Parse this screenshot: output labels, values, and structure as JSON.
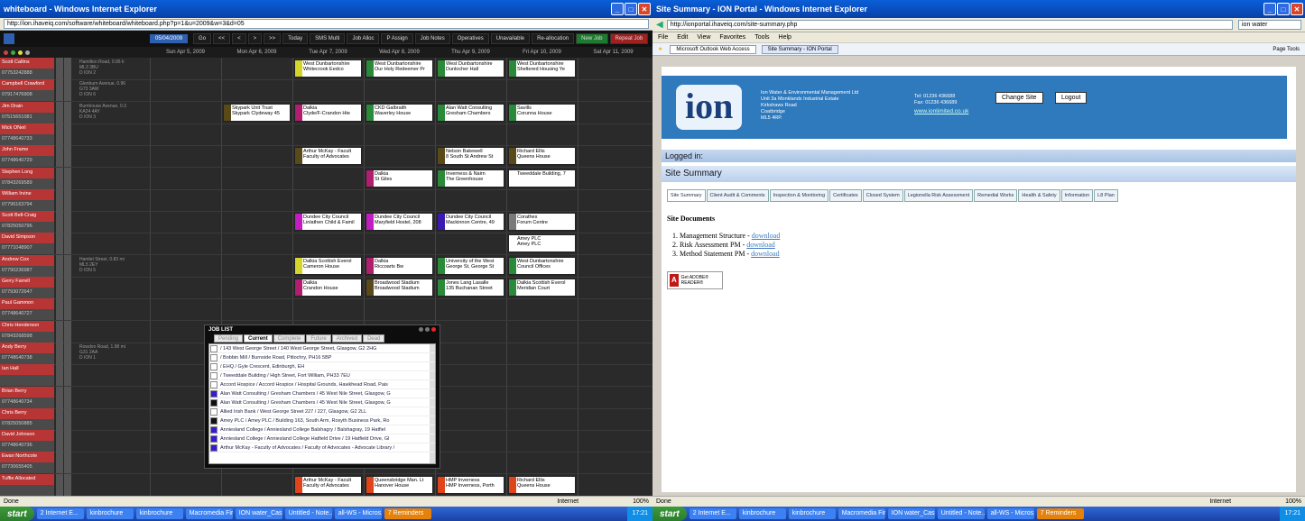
{
  "left": {
    "title": "whiteboard - Windows Internet Explorer",
    "url": "http://ion.ihaveiq.com/software/whiteboard/whiteboard.php?p=1&u=2009&w=3&d=05",
    "toolbar": {
      "date": "05/04/2009",
      "buttons": [
        "Go",
        "<<",
        "<",
        ">",
        ">>",
        "Today",
        "SMS Multi",
        "Job Alloc",
        "P Assign",
        "Job Notes",
        "Operatives",
        "Unavailable",
        "Re-allocation",
        "New Job",
        "Repeat Job"
      ]
    },
    "days": [
      "Sun Apr 5, 2009",
      "Mon Apr 6, 2009",
      "Tue Apr 7, 2009",
      "Wed Apr 8, 2009",
      "Thu Apr 9, 2009",
      "Fri Apr 10, 2009",
      "Sat Apr 11, 2009"
    ],
    "operatives": [
      {
        "name": "Scott Callins",
        "phone": "07753242888",
        "loc": "Hamilton Road, 0.95 k|ML3 3BU|D  ION 2"
      },
      {
        "name": "Campbell Crawford",
        "phone": "07917476908",
        "loc": "Glenburn Avenue, 0.96|G73 3AW|D  ION 6"
      },
      {
        "name": "Jim Drain",
        "phone": "07515651081",
        "loc": "Burnhouse Avenue, 0.3|KA24 4AY|D  ION 3"
      },
      {
        "name": "Mick ONeil",
        "phone": "07748640733",
        "loc": ""
      },
      {
        "name": "John Frame",
        "phone": "07748640729",
        "loc": ""
      },
      {
        "name": "Stephen Long",
        "phone": "07843269589",
        "loc": ""
      },
      {
        "name": "William Irvine",
        "phone": "07796163794",
        "loc": ""
      },
      {
        "name": "Scott Bell-Craig",
        "phone": "07825050796",
        "loc": ""
      },
      {
        "name": "David Simpson",
        "phone": "07771048907",
        "loc": ""
      },
      {
        "name": "Andrew Cox",
        "phone": "07790236987",
        "loc": "Hamlet Street, 0.83 mi|ML5 2EY|D  ION 5"
      },
      {
        "name": "Gerry Farrell",
        "phone": "07793072647",
        "loc": ""
      },
      {
        "name": "Paul Gammon",
        "phone": "07748640727",
        "loc": ""
      },
      {
        "name": "Chris Henderson",
        "phone": "07843268598",
        "loc": ""
      },
      {
        "name": "Andy Berry",
        "phone": "07748640738",
        "loc": "Rowdon Road, 1.98 mi|G31 2AA|D  ION 1"
      },
      {
        "name": "Ian Hall",
        "phone": "",
        "loc": ""
      },
      {
        "name": "Brian Berry",
        "phone": "07748640734",
        "loc": ""
      },
      {
        "name": "Chris Berry",
        "phone": "07825050885",
        "loc": ""
      },
      {
        "name": "David Johnson",
        "phone": "07748640736",
        "loc": ""
      },
      {
        "name": "Ewan Northcote",
        "phone": "07730655405",
        "loc": ""
      },
      {
        "name": "Tuffie Allocated",
        "phone": "",
        "loc": ""
      }
    ],
    "jobs": [
      {
        "row": 0,
        "day": 2,
        "color": "#d4d42a",
        "l1": "West Dunbartonshire",
        "l2": "Whitecrook Eedco"
      },
      {
        "row": 0,
        "day": 3,
        "color": "#2a8a3a",
        "l1": "West Dunbartonshire",
        "l2": "Our Holy Redeemer Pr"
      },
      {
        "row": 0,
        "day": 4,
        "color": "#2a8a3a",
        "l1": "West Dunbartonshire",
        "l2": "Dunlocher Hall"
      },
      {
        "row": 0,
        "day": 5,
        "color": "#2a8a3a",
        "l1": "West Dunbartonshire",
        "l2": "Sheltered Housing Ye"
      },
      {
        "row": 2,
        "day": 1,
        "color": "#5a4a1a",
        "l1": "Skypark Unit Trust",
        "l2": "Skypark Clydeway 45"
      },
      {
        "row": 2,
        "day": 2,
        "color": "#b01e6e",
        "l1": "Dalkia",
        "l2": "Clyde/F-Crandon Hte"
      },
      {
        "row": 2,
        "day": 3,
        "color": "#2a8a3a",
        "l1": "CKD Galbraith",
        "l2": "Waverley House"
      },
      {
        "row": 2,
        "day": 4,
        "color": "#2a8a3a",
        "l1": "Alan Watt Consulting",
        "l2": "Gresham Chambers"
      },
      {
        "row": 2,
        "day": 5,
        "color": "#2a8a3a",
        "l1": "Savills",
        "l2": "Corunna House"
      },
      {
        "row": 4,
        "day": 2,
        "color": "#5a4a1a",
        "l1": "Arthur McKay - Facult",
        "l2": "Faculty of Advocates"
      },
      {
        "row": 4,
        "day": 4,
        "color": "#5a4a1a",
        "l1": "Nelson Bakewell",
        "l2": "8 South St Andrew St"
      },
      {
        "row": 4,
        "day": 5,
        "color": "#5a4a1a",
        "l1": "Richard Ellis",
        "l2": "Queens House"
      },
      {
        "row": 5,
        "day": 3,
        "color": "#b01e6e",
        "l1": "Dalkia",
        "l2": "St Giles"
      },
      {
        "row": 5,
        "day": 4,
        "color": "#2a8a3a",
        "l1": "Inverness & Nairn",
        "l2": "The Greenhouse"
      },
      {
        "row": 5,
        "day": 5,
        "color": "#ffffff",
        "l1": "Tweeddale Building, 7",
        "l2": ""
      },
      {
        "row": 7,
        "day": 2,
        "color": "#c01ec0",
        "l1": "Dundee City Council",
        "l2": "Linlathen Child & Famil"
      },
      {
        "row": 7,
        "day": 3,
        "color": "#c01ec0",
        "l1": "Dundee City Council",
        "l2": "Maryfield Hostel, 208"
      },
      {
        "row": 7,
        "day": 4,
        "color": "#3a1ab0",
        "l1": "Dundee City Council",
        "l2": "Mackinnon Centre, 49"
      },
      {
        "row": 7,
        "day": 5,
        "color": "#7a7a7a",
        "l1": "Corathes",
        "l2": "Forum Centre"
      },
      {
        "row": 8,
        "day": 5,
        "color": "#ffffff",
        "l1": "Amey PLC",
        "l2": "Amey PLC"
      },
      {
        "row": 9,
        "day": 2,
        "color": "#d4d42a",
        "l1": "Dalkia Scottish Everol",
        "l2": "Cameron House"
      },
      {
        "row": 9,
        "day": 3,
        "color": "#b01e6e",
        "l1": "Dalkia",
        "l2": "Riccoarts Bw"
      },
      {
        "row": 9,
        "day": 4,
        "color": "#2a8a3a",
        "l1": "University of the West",
        "l2": "George St, George St"
      },
      {
        "row": 9,
        "day": 5,
        "color": "#2a8a3a",
        "l1": "West Dunbartonshire",
        "l2": "Council Offices"
      },
      {
        "row": 10,
        "day": 2,
        "color": "#b01e6e",
        "l1": "Dalkia",
        "l2": "Crandon House"
      },
      {
        "row": 10,
        "day": 3,
        "color": "#5a4a1a",
        "l1": "Broadwood Stadium",
        "l2": "Broadwood Stadium"
      },
      {
        "row": 10,
        "day": 4,
        "color": "#2a8a3a",
        "l1": "Jones Lang Lasalle",
        "l2": "135 Buchanan Street"
      },
      {
        "row": 10,
        "day": 5,
        "color": "#2a8a3a",
        "l1": "Dalkia Scottish Everol",
        "l2": "Meridian Court"
      },
      {
        "row": 19,
        "day": 2,
        "color": "#e0441a",
        "l1": "Arthur McKay - Facult",
        "l2": "Faculty of Advocates"
      },
      {
        "row": 19,
        "day": 3,
        "color": "#e0441a",
        "l1": "Queensbridge Man. Lt",
        "l2": "Hanover House"
      },
      {
        "row": 19,
        "day": 4,
        "color": "#e0441a",
        "l1": "HMP Inverness",
        "l2": "HMP Inverness, Porth"
      },
      {
        "row": 19,
        "day": 5,
        "color": "#e0441a",
        "l1": "Richard Ellis",
        "l2": "Queens House"
      }
    ],
    "joblist": {
      "title": "JOB LIST",
      "tabs": [
        "Pending",
        "Current",
        "Complete",
        "Future",
        "Archived",
        "Dead"
      ],
      "items": [
        {
          "color": "#ffffff",
          "text": "/ 143 West George Street / 140 West George Street, Glasgow, G2 2HG"
        },
        {
          "color": "#ffffff",
          "text": "/ Bobbin Mill / Burnside Road, Pitlochry, PH16 5BP"
        },
        {
          "color": "#ffffff",
          "text": "/ EHQ / Gyle Crescent, Edinburgh, EH"
        },
        {
          "color": "#ffffff",
          "text": "/ Tweeddale Building / High Street, Fort William, PH33 7EU"
        },
        {
          "color": "#ffffff",
          "text": "Accord Hospice / Accord Hospice / Hospital Grounds, Hawkhead Road, Pais"
        },
        {
          "color": "#3a1ad0",
          "text": "Alan Watt Consulting / Gresham Chambers / 45 West Nile Street, Glasgow, G"
        },
        {
          "color": "#111111",
          "text": "Alan Watt Consulting / Gresham Chambers / 45 West Nile Street, Glasgow, G"
        },
        {
          "color": "#ffffff",
          "text": "Allied Irish Bank / West George Street 227 / 227, Glasgow, G2 2LL"
        },
        {
          "color": "#111111",
          "text": "Amey PLC / Amey PLC / Building 163, South Arm, Rosyth Business Park, Ro"
        },
        {
          "color": "#3a1ad0",
          "text": "Anniesland College / Anniesland College Balshagry / Balshagray, 19 Hatfiel"
        },
        {
          "color": "#3a1ad0",
          "text": "Anniesland College / Anniesland College Hatfield Drive / 19 Hatfield Drive, Gl"
        },
        {
          "color": "#3a1ad0",
          "text": "Arthur McKay - Faculty of Advocates / Faculty of Advocates - Advocate Library /"
        }
      ]
    },
    "status": {
      "left": "Done",
      "zone": "Internet",
      "zoom": "100%"
    }
  },
  "right": {
    "title": "Site Summary - ION Portal - Windows Internet Explorer",
    "url": "http://ionportal.ihaveiq.com/site-summary.php",
    "search": "ion water",
    "menu": [
      "File",
      "Edit",
      "View",
      "Favorites",
      "Tools",
      "Help"
    ],
    "tabs": [
      "Microsoft Outlook Web Access",
      "Site Summary - ION Portal"
    ],
    "cmd": "Page  Tools",
    "banner": {
      "logo": "ion",
      "address": "Ion Water & Environmental Management Ltd\nUnit 3a Monklands Industrial Estate\nKirkshaws Road\nCoatbridge\nML5 4RP.",
      "tel": "Tel: 01236 436688\nFax: 01236 436689",
      "web": "www.ionlimited.co.uk",
      "change_site": "Change Site",
      "logout": "Logout"
    },
    "logged_in": "Logged in:",
    "heading": "Site Summary",
    "navtabs": [
      "Site Summary",
      "Client Audit & Comments",
      "Inspection & Monitoring",
      "Certificates",
      "Closed System",
      "Legionella Risk Assessment",
      "Remedial Works",
      "Health & Safety",
      "Information",
      "L8 Plan"
    ],
    "docs_title": "Site Documents",
    "docs": [
      {
        "name": "Management Structure",
        "link": "download"
      },
      {
        "name": "Risk Assessment PM",
        "link": "download"
      },
      {
        "name": "Method Statement PM",
        "link": "download"
      }
    ],
    "adobe": "Get ADOBE® READER®",
    "status": {
      "left": "Done",
      "zone": "Internet",
      "zoom": "100%"
    }
  },
  "taskbar": {
    "start": "start",
    "tasks": [
      "2 Internet E...",
      "kinbrochure",
      "kinbrochure",
      "Macromedia Fir...",
      "ION water_Cas...",
      "Untitled - Note...",
      "all-WS - Micros...",
      "7 Reminders"
    ],
    "clock": "17:21"
  }
}
